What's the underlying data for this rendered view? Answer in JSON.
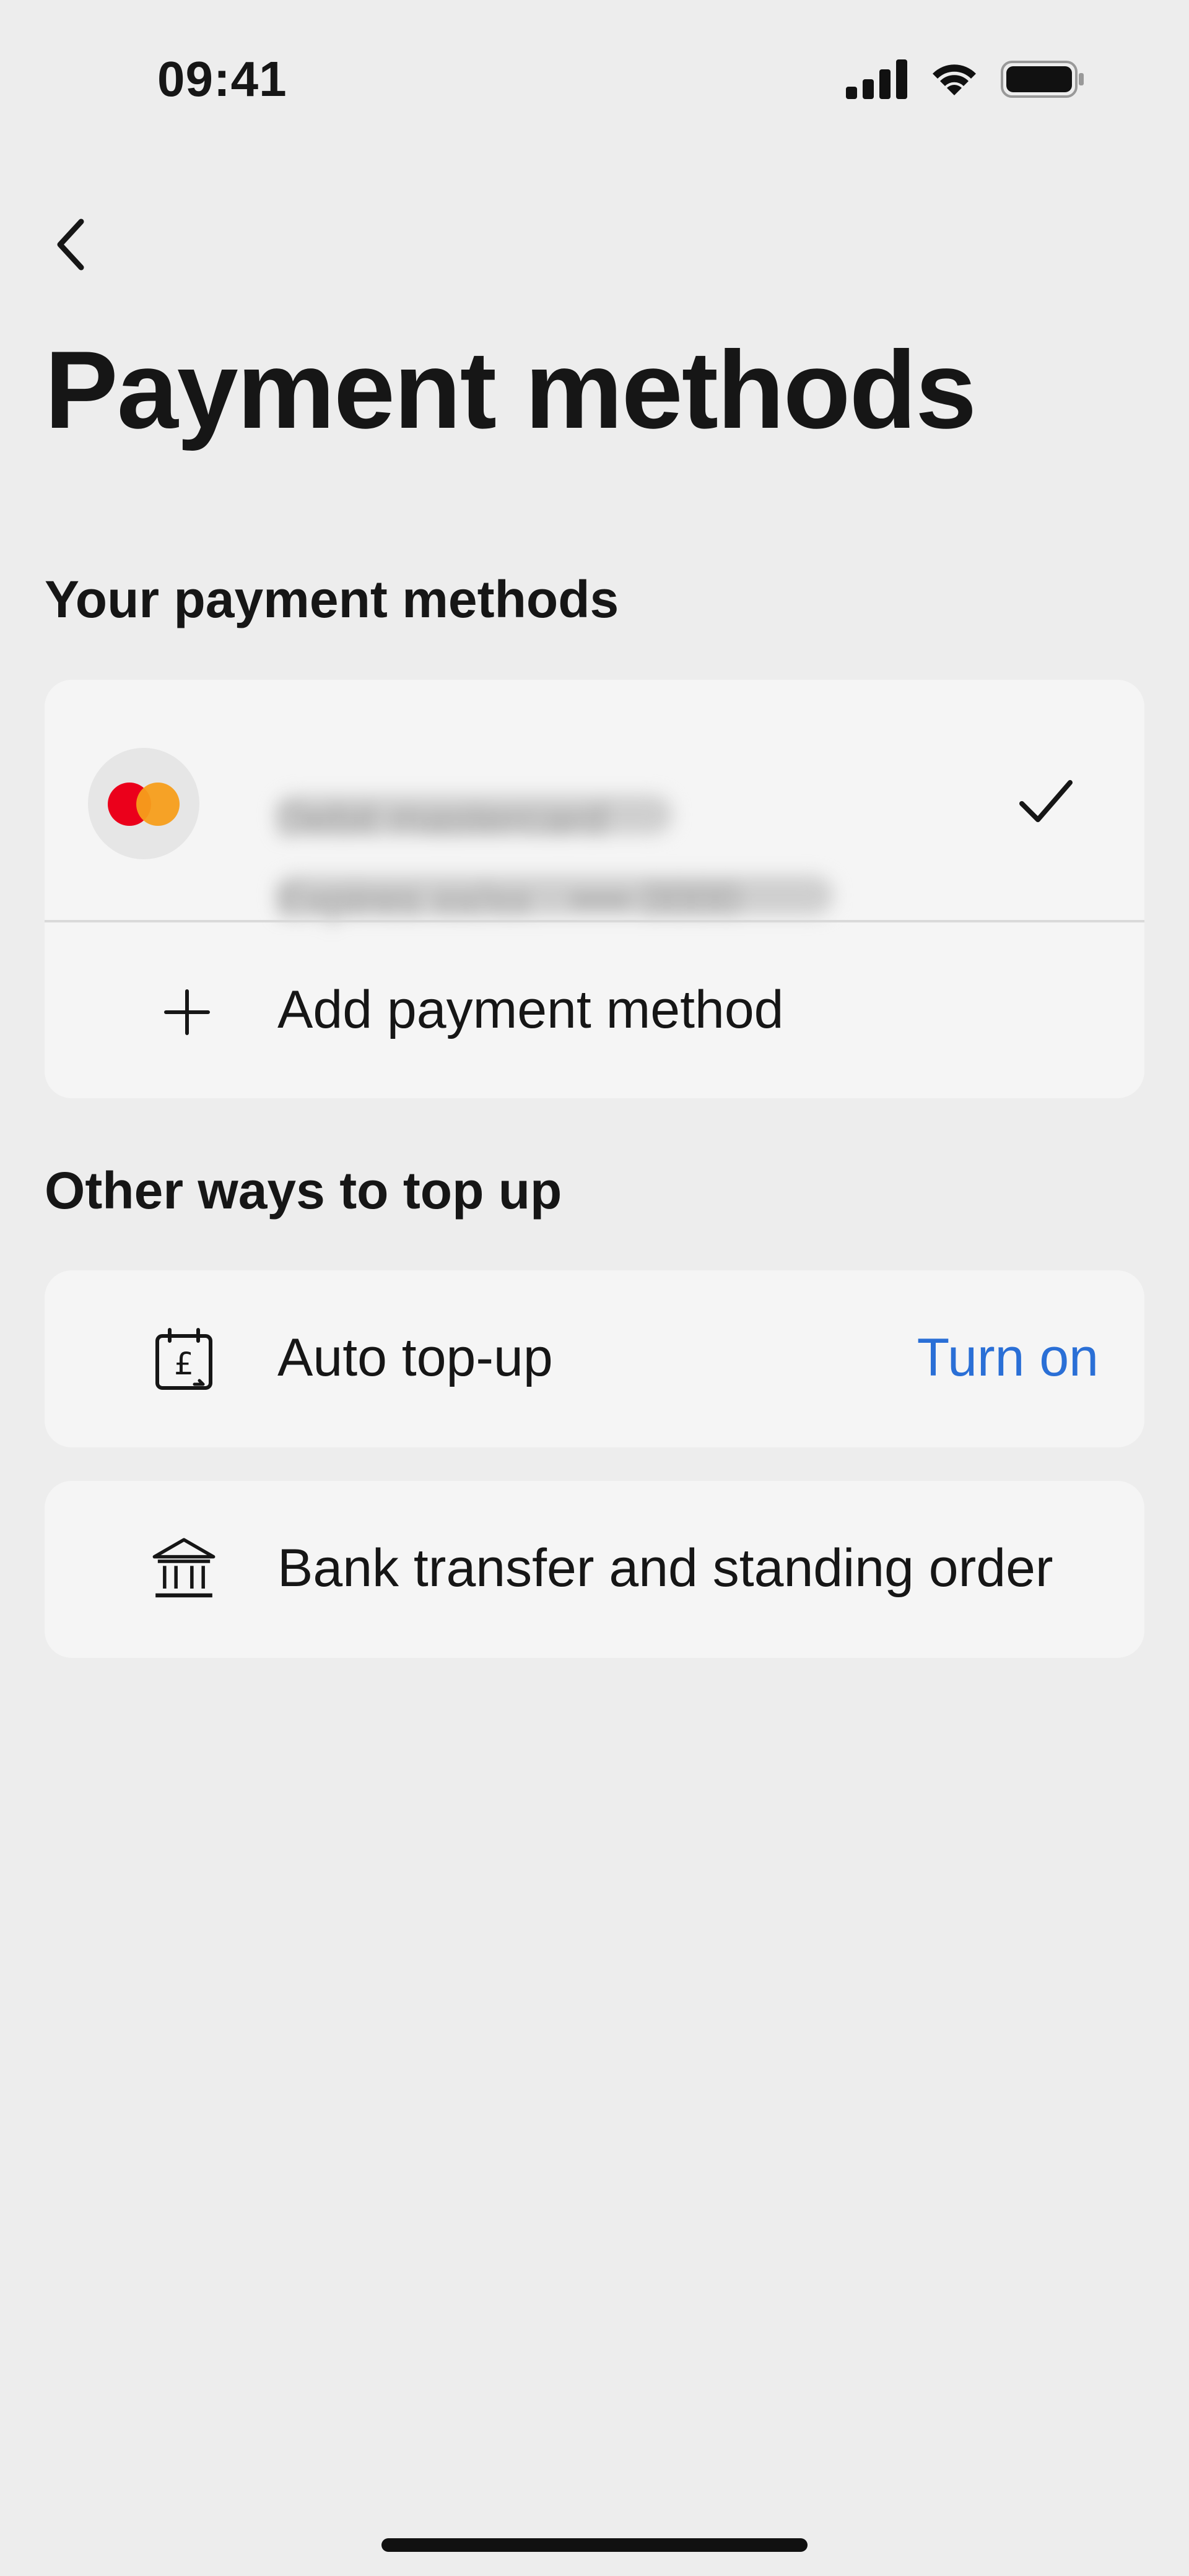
{
  "status_bar": {
    "time": "09:41"
  },
  "header": {
    "back_icon": "chevron-left-icon",
    "title": "Payment methods"
  },
  "your_methods": {
    "heading": "Your payment methods",
    "saved_card": {
      "brand_icon": "mastercard-icon",
      "name_redacted": "Debit mastercard",
      "detail_redacted": "Expires xx/xx · •••• 0000",
      "selected": true,
      "selected_icon": "checkmark-icon"
    },
    "add_method": {
      "icon": "plus-icon",
      "label": "Add payment method"
    }
  },
  "other_ways": {
    "heading": "Other ways to top up",
    "auto_topup": {
      "icon": "calendar-pound-icon",
      "label": "Auto top-up",
      "action": "Turn on"
    },
    "bank_transfer": {
      "icon": "bank-icon",
      "label": "Bank transfer and standing order"
    }
  },
  "colors": {
    "background": "#ededed",
    "card": "#f5f5f5",
    "accent": "#2a6fd6",
    "text": "#161616"
  }
}
